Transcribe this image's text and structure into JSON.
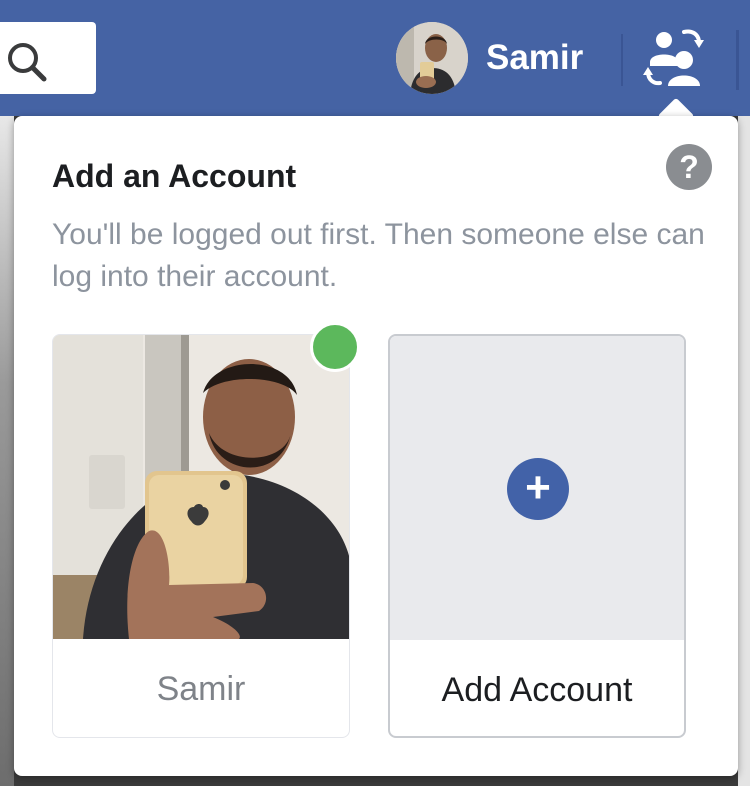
{
  "header": {
    "profile_name": "Samir",
    "accent_color": "#4563a4"
  },
  "icons": {
    "search": "search-icon",
    "switch_account": "switch-account-icon",
    "help": "help-icon",
    "plus": "plus-icon"
  },
  "popup": {
    "title": "Add an Account",
    "help_glyph": "?",
    "description": "You'll be logged out first. Then someone else can log into their account.",
    "accounts": [
      {
        "label": "Samir",
        "online": true,
        "online_color": "#5cb85c"
      },
      {
        "label": "Add Account",
        "plus_glyph": "+"
      }
    ]
  }
}
